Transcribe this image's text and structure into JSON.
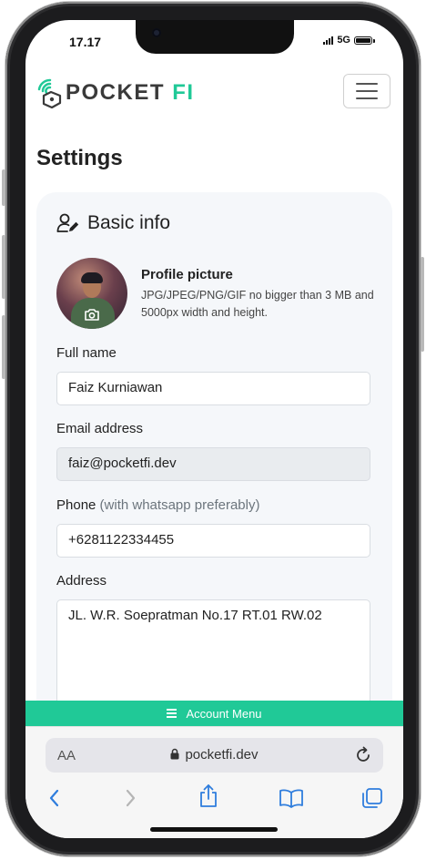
{
  "status_bar": {
    "time": "17.17",
    "network": "5G"
  },
  "navbar": {
    "logo": {
      "text_main": "POCKET",
      "text_accent": "FI"
    },
    "menu_icon": "hamburger-icon"
  },
  "page": {
    "title": "Settings"
  },
  "basic_info": {
    "title": "Basic info",
    "icon": "user-edit-icon",
    "profile_picture": {
      "title": "Profile picture",
      "description": "JPG/JPEG/PNG/GIF no bigger than 3 MB and 5000px width and height.",
      "camera_icon": "camera-icon"
    },
    "full_name": {
      "label": "Full name",
      "value": "Faiz Kurniawan"
    },
    "email": {
      "label": "Email address",
      "value": "faiz@pocketfi.dev"
    },
    "phone": {
      "label": "Phone",
      "hint": "(with whatsapp preferably)",
      "value": "+6281122334455"
    },
    "address": {
      "label": "Address",
      "value": "JL. W.R. Soepratman No.17 RT.01 RW.02"
    }
  },
  "account_menu": {
    "label": "Account Menu"
  },
  "browser": {
    "aa_label": "AA",
    "url": "pocketfi.dev",
    "toolbar_icons": [
      "back-icon",
      "forward-icon",
      "share-icon",
      "bookmarks-icon",
      "tabs-icon"
    ]
  },
  "colors": {
    "accent": "#20c997",
    "card_bg": "#f5f7fa"
  }
}
